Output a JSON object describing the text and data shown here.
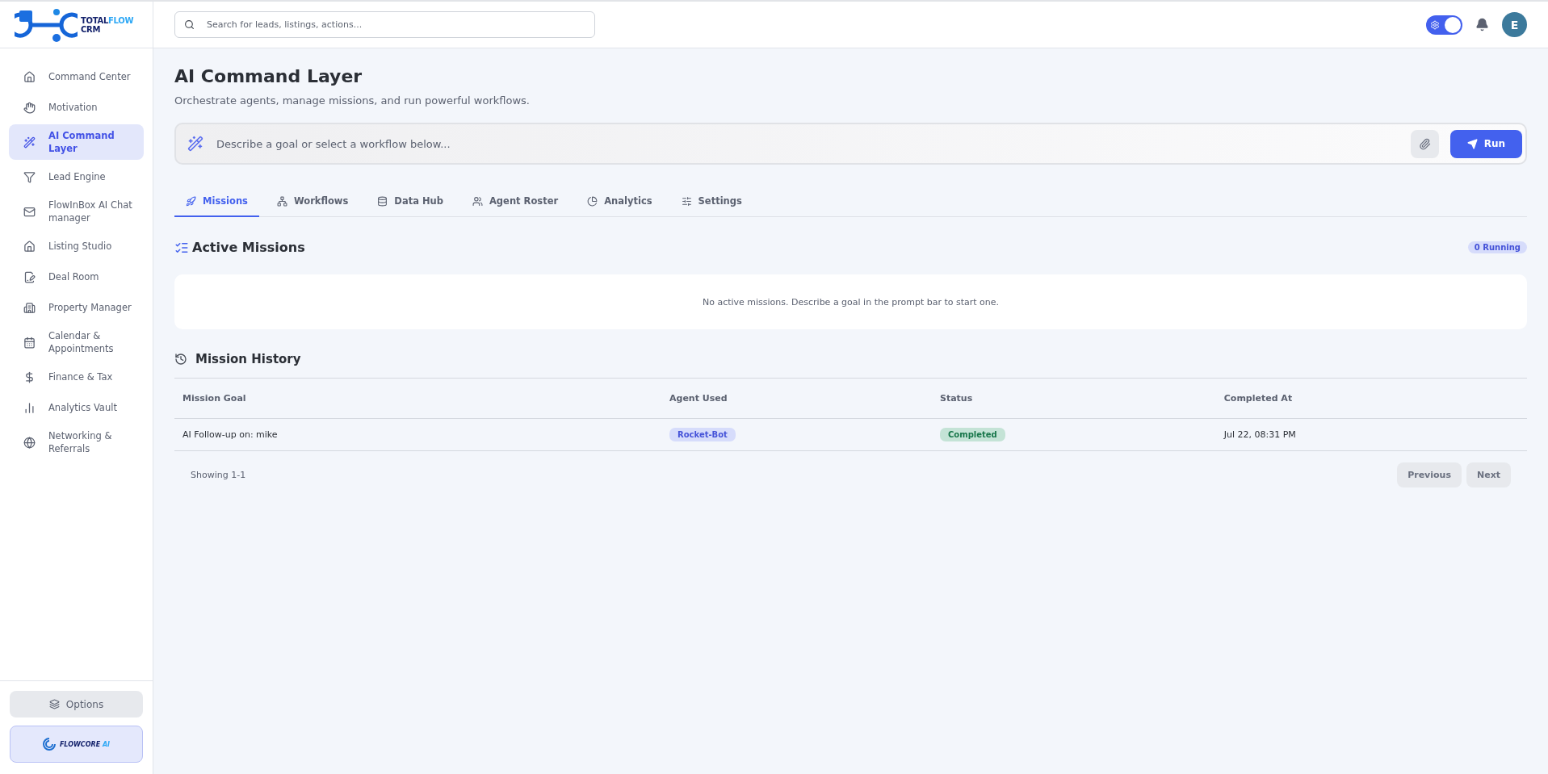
{
  "logo": {
    "parts": [
      {
        "text": "TOTAL",
        "kind": "dark"
      },
      {
        "text": "FLOW",
        "kind": "light"
      }
    ],
    "second_line": "CRM"
  },
  "sidebar": {
    "items": [
      {
        "label": "Command Center",
        "selected": false
      },
      {
        "label": "Motivation",
        "selected": false
      },
      {
        "label": "AI Command Layer",
        "selected": true
      },
      {
        "label": "Lead Engine",
        "selected": false
      },
      {
        "label": "FlowInBox AI Chat manager",
        "selected": false
      },
      {
        "label": "Listing Studio",
        "selected": false
      },
      {
        "label": "Deal Room",
        "selected": false
      },
      {
        "label": "Property Manager",
        "selected": false
      },
      {
        "label": "Calendar & Appointments",
        "selected": false
      },
      {
        "label": "Finance & Tax",
        "selected": false
      },
      {
        "label": "Analytics Vault",
        "selected": false
      },
      {
        "label": "Networking & Referrals",
        "selected": false
      }
    ],
    "options_button": "Options",
    "brand": {
      "parts": [
        {
          "text": "FLOWCORE",
          "kind": "dark"
        },
        {
          "text": "AI",
          "kind": "light"
        }
      ]
    }
  },
  "topbar": {
    "search": {
      "placeholder": "Search for leads, listings, actions..."
    },
    "theme_toggle": {
      "on": true
    },
    "avatar": "E"
  },
  "page": {
    "title": "AI Command Layer",
    "subtitle": "Orchestrate agents, manage missions, and run powerful workflows.",
    "prompt": {
      "placeholder": "Describe a goal or select a workflow below...",
      "run_button": "Run"
    },
    "tabs": [
      {
        "label": "Missions",
        "selected": true
      },
      {
        "label": "Workflows",
        "selected": false
      },
      {
        "label": "Data Hub",
        "selected": false
      },
      {
        "label": "Agent Roster",
        "selected": false
      },
      {
        "label": "Analytics",
        "selected": false
      },
      {
        "label": "Settings",
        "selected": false
      }
    ],
    "active_missions": {
      "title": "Active Missions",
      "badge": "0 Running",
      "empty": "No active missions. Describe a goal in the prompt bar to start one."
    },
    "history": {
      "title": "Mission History",
      "columns": [
        "Mission Goal",
        "Agent Used",
        "Status",
        "Completed At"
      ],
      "rows": [
        {
          "goal": "AI Follow-up on: mike",
          "agent": "Rocket-Bot",
          "status": "Completed",
          "completed_at": "Jul 22, 08:31 PM"
        }
      ],
      "showing": "Showing 1-1",
      "buttons": [
        "Previous",
        "Next"
      ]
    }
  }
}
